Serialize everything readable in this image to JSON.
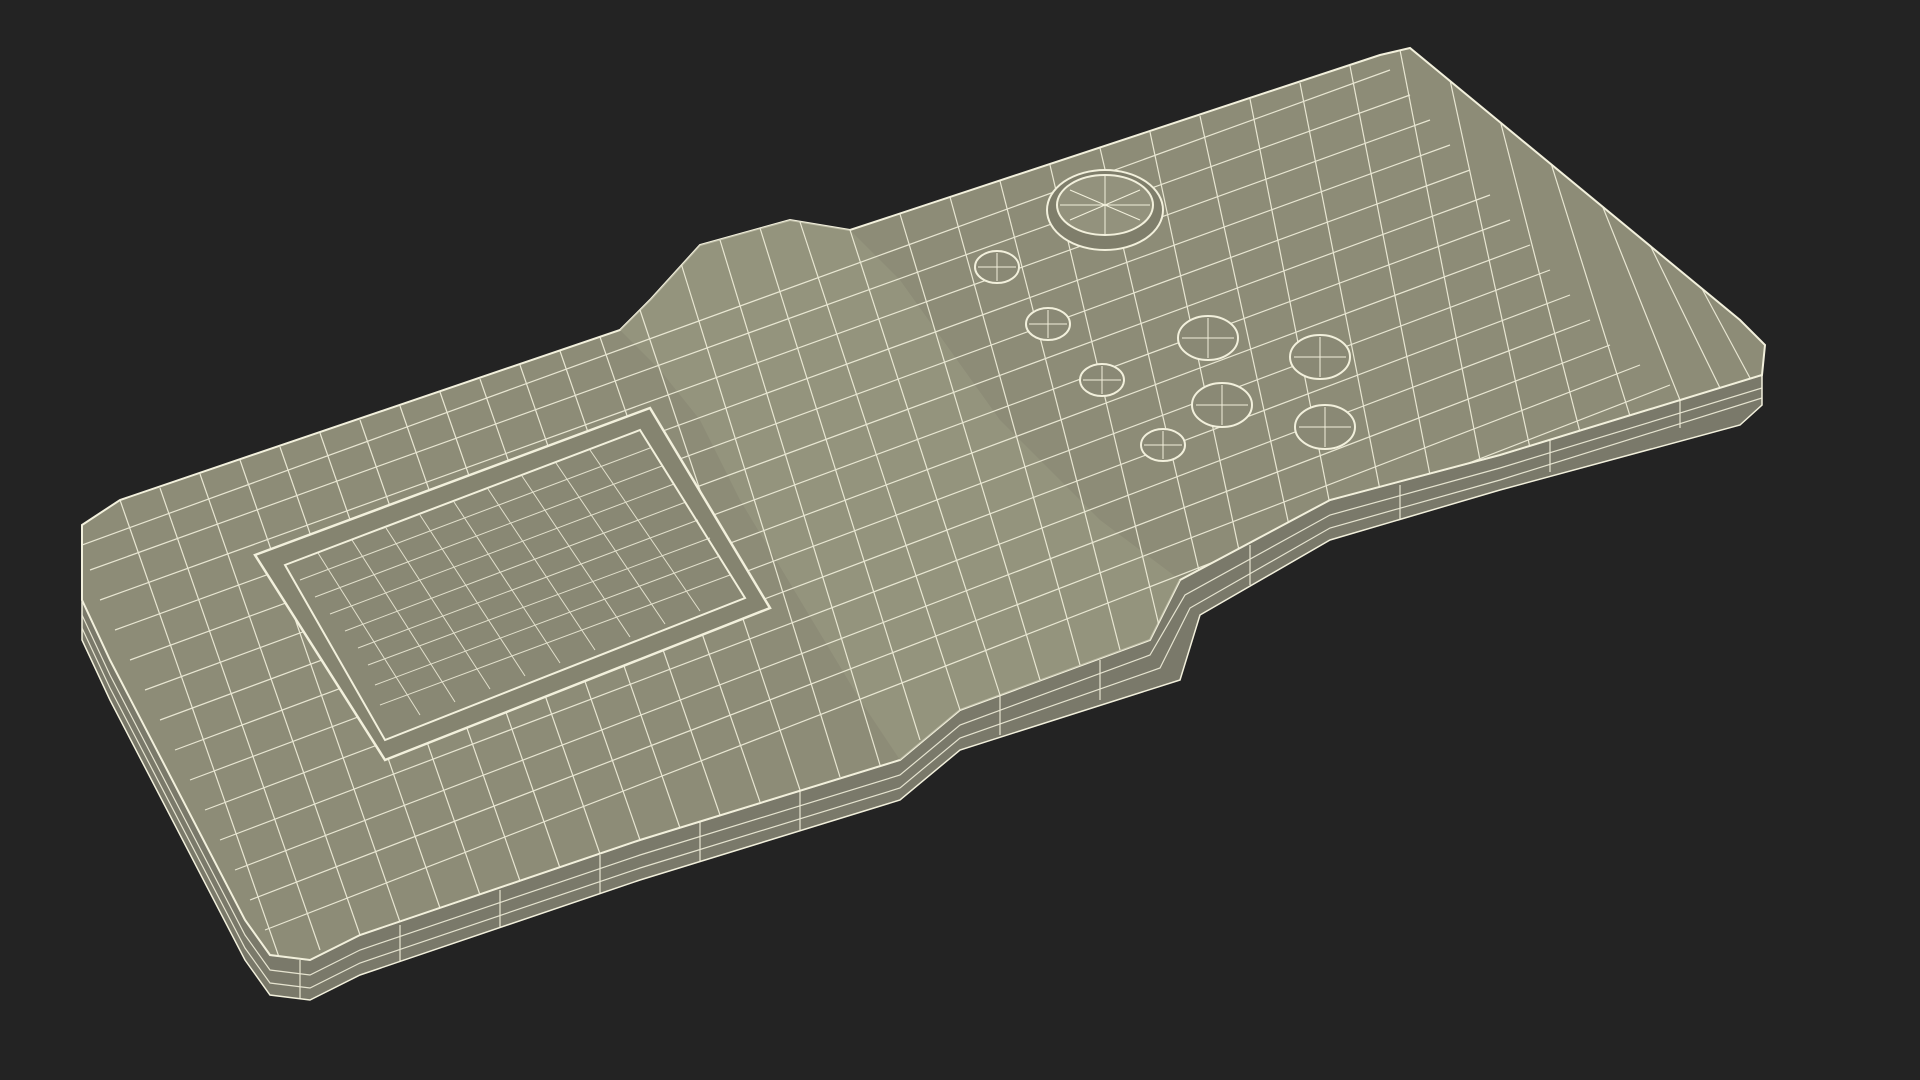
{
  "scene": {
    "subject": "wireframe-handheld-device",
    "render_mode": "wireframe-on-shaded",
    "colors": {
      "background": "#232323",
      "surface": "#8d8c77",
      "surface_light": "#9b9a84",
      "surface_dark": "#6f6e5d",
      "wire": "#f2f0dc"
    },
    "buttons": {
      "main_button": "round-large-button",
      "dpad_buttons": 4,
      "action_buttons": 4
    }
  }
}
